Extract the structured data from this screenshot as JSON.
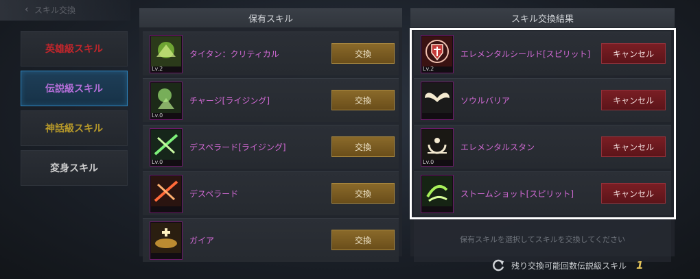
{
  "header": {
    "title": "スキル交換"
  },
  "sidebar": {
    "items": [
      {
        "label": "英雄級スキル",
        "color": "#c0262c",
        "active": false
      },
      {
        "label": "伝説級スキル",
        "color": "#b56fd9",
        "active": true
      },
      {
        "label": "神話級スキル",
        "color": "#b89a2a",
        "active": false
      },
      {
        "label": "変身スキル",
        "color": "#cfcfcf",
        "active": false
      }
    ]
  },
  "owned": {
    "title": "保有スキル",
    "button_label": "交換",
    "skills": [
      {
        "name": "タイタン：クリティカル",
        "level": "Lv.2",
        "icon": "titan-critical-icon"
      },
      {
        "name": "チャージ[ライジング]",
        "level": "Lv.0",
        "icon": "charge-rising-icon"
      },
      {
        "name": "デスペラード[ライジング]",
        "level": "Lv.0",
        "icon": "desperado-rising-icon"
      },
      {
        "name": "デスペラード",
        "level": "",
        "icon": "desperado-icon"
      },
      {
        "name": "ガイア",
        "level": "",
        "icon": "gaia-icon"
      }
    ]
  },
  "result": {
    "title": "スキル交換結果",
    "button_label": "キャンセル",
    "skills": [
      {
        "name": "エレメンタルシールド[スピリット]",
        "level": "Lv.2",
        "icon": "elemental-shield-icon"
      },
      {
        "name": "ソウルバリア",
        "level": "",
        "icon": "soul-barrier-icon"
      },
      {
        "name": "エレメンタルスタン",
        "level": "Lv.0",
        "icon": "elemental-stun-icon"
      },
      {
        "name": "ストームショット[スピリット]",
        "level": "",
        "icon": "storm-shot-icon"
      }
    ],
    "hint": "保有スキルを選択してスキルを交換してください"
  },
  "footer": {
    "label": "残り交換可能回数伝説級スキル",
    "count": "1"
  },
  "colors": {
    "skill_name": "#d36ad6",
    "exchange_button": "#8a6a2a",
    "cancel_button": "#7a1e24",
    "active_tab_border": "#2e86c1",
    "count": "#e6c65a"
  }
}
